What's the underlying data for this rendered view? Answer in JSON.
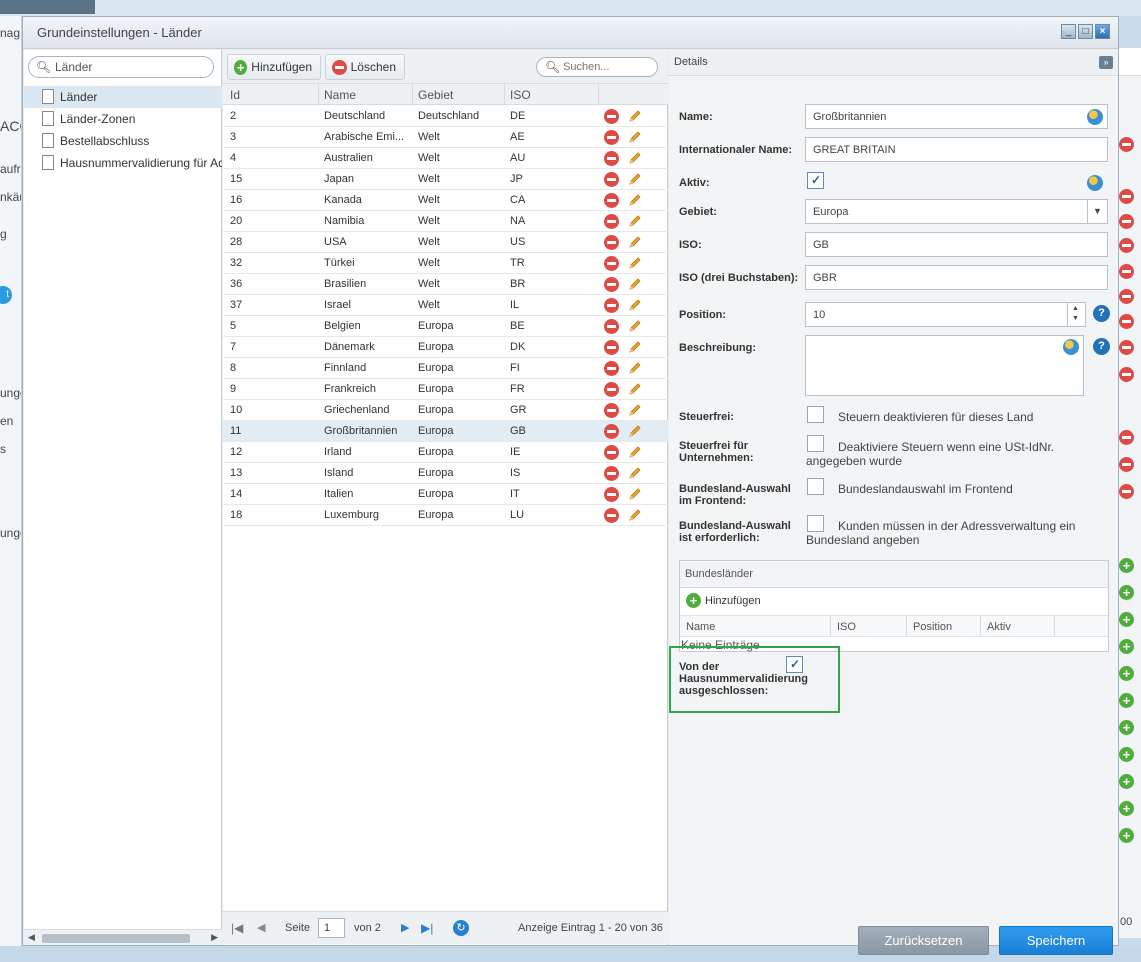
{
  "background": {
    "left_fragments": [
      "nag",
      "ACO",
      "aufr",
      "nkäu",
      "g",
      "t",
      "unge",
      "en",
      "s",
      "unge"
    ],
    "right_value": "00"
  },
  "window": {
    "title": "Grundeinstellungen - Länder",
    "btn_minimize": "_",
    "btn_maximize": "□",
    "btn_close": "×"
  },
  "tree": {
    "search_value": "Länder",
    "items": [
      {
        "label": "Länder"
      },
      {
        "label": "Länder-Zonen"
      },
      {
        "label": "Bestellabschluss"
      },
      {
        "label": "Hausnummervalidierung für Adressen"
      }
    ]
  },
  "grid": {
    "add_label": "Hinzufügen",
    "delete_label": "Löschen",
    "search_placeholder": "Suchen...",
    "columns": [
      "Id",
      "Name",
      "Gebiet",
      "ISO"
    ],
    "rows": [
      {
        "id": "2",
        "name": "Deutschland",
        "area": "Deutschland",
        "iso": "DE"
      },
      {
        "id": "3",
        "name": "Arabische Emi...",
        "area": "Welt",
        "iso": "AE"
      },
      {
        "id": "4",
        "name": "Australien",
        "area": "Welt",
        "iso": "AU"
      },
      {
        "id": "15",
        "name": "Japan",
        "area": "Welt",
        "iso": "JP"
      },
      {
        "id": "16",
        "name": "Kanada",
        "area": "Welt",
        "iso": "CA"
      },
      {
        "id": "20",
        "name": "Namibia",
        "area": "Welt",
        "iso": "NA"
      },
      {
        "id": "28",
        "name": "USA",
        "area": "Welt",
        "iso": "US"
      },
      {
        "id": "32",
        "name": "Türkei",
        "area": "Welt",
        "iso": "TR"
      },
      {
        "id": "36",
        "name": "Brasilien",
        "area": "Welt",
        "iso": "BR"
      },
      {
        "id": "37",
        "name": "Israel",
        "area": "Welt",
        "iso": "IL"
      },
      {
        "id": "5",
        "name": "Belgien",
        "area": "Europa",
        "iso": "BE"
      },
      {
        "id": "7",
        "name": "Dänemark",
        "area": "Europa",
        "iso": "DK"
      },
      {
        "id": "8",
        "name": "Finnland",
        "area": "Europa",
        "iso": "FI"
      },
      {
        "id": "9",
        "name": "Frankreich",
        "area": "Europa",
        "iso": "FR"
      },
      {
        "id": "10",
        "name": "Griechenland",
        "area": "Europa",
        "iso": "GR"
      },
      {
        "id": "11",
        "name": "Großbritannien",
        "area": "Europa",
        "iso": "GB"
      },
      {
        "id": "12",
        "name": "Irland",
        "area": "Europa",
        "iso": "IE"
      },
      {
        "id": "13",
        "name": "Island",
        "area": "Europa",
        "iso": "IS"
      },
      {
        "id": "14",
        "name": "Italien",
        "area": "Europa",
        "iso": "IT"
      },
      {
        "id": "18",
        "name": "Luxemburg",
        "area": "Europa",
        "iso": "LU"
      }
    ],
    "pager": {
      "page_label": "Seite",
      "page_value": "1",
      "of_label": "von 2",
      "display_info": "Anzeige Eintrag 1 - 20 von 36"
    }
  },
  "details": {
    "title": "Details",
    "collapse_icon": "»",
    "name_label": "Name:",
    "name_value": "Großbritannien",
    "intl_name_label": "Internationaler Name:",
    "intl_name_value": "GREAT BRITAIN",
    "active_label": "Aktiv:",
    "area_label": "Gebiet:",
    "area_value": "Europa",
    "iso_label": "ISO:",
    "iso_value": "GB",
    "iso3_label": "ISO (drei Buchstaben):",
    "iso3_value": "GBR",
    "position_label": "Position:",
    "position_value": "10",
    "description_label": "Beschreibung:",
    "taxfree_label": "Steuerfrei:",
    "taxfree_text": "Steuern deaktivieren für dieses Land",
    "taxfree_company_label": "Steuerfrei für Unternehmen:",
    "taxfree_company_text": "Deaktiviere Steuern wenn eine USt-IdNr. angegeben wurde",
    "state_frontend_label": "Bundesland-Auswahl im Frontend:",
    "state_frontend_text": "Bundeslandauswahl im Frontend",
    "state_required_label": "Bundesland-Auswahl ist erforderlich:",
    "state_required_text": "Kunden müssen in der Adressverwaltung ein Bundesland angeben",
    "states": {
      "title": "Bundesländer",
      "add_label": "Hinzufügen",
      "columns": [
        "Name",
        "ISO",
        "Position",
        "Aktiv"
      ],
      "empty": "Keine Einträge"
    },
    "house_validation_label": "Von der Hausnummervalidierung ausgeschlossen:",
    "reset_label": "Zurücksetzen",
    "save_label": "Speichern"
  }
}
